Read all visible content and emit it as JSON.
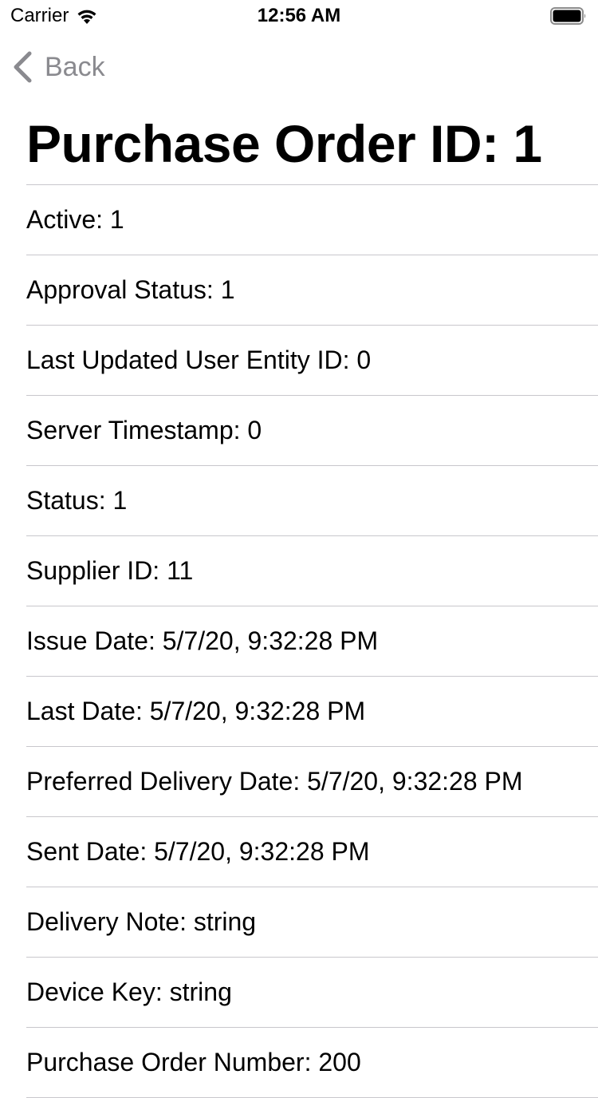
{
  "status_bar": {
    "carrier": "Carrier",
    "time": "12:56 AM",
    "wifi_icon": "wifi-icon",
    "battery_icon": "battery-icon"
  },
  "nav": {
    "back_label": "Back",
    "back_icon": "chevron-left-icon",
    "tint_color": "#8a8a8f"
  },
  "page": {
    "title": "Purchase Order ID: 1"
  },
  "fields": [
    {
      "label": "Active",
      "value": "1"
    },
    {
      "label": "Approval Status",
      "value": "1"
    },
    {
      "label": "Last Updated User Entity ID",
      "value": "0"
    },
    {
      "label": "Server Timestamp",
      "value": "0"
    },
    {
      "label": "Status",
      "value": "1"
    },
    {
      "label": "Supplier ID",
      "value": "11"
    },
    {
      "label": "Issue Date",
      "value": "5/7/20, 9:32:28 PM"
    },
    {
      "label": "Last Date",
      "value": "5/7/20, 9:32:28 PM"
    },
    {
      "label": "Preferred Delivery Date",
      "value": "5/7/20, 9:32:28 PM"
    },
    {
      "label": "Sent Date",
      "value": "5/7/20, 9:32:28 PM"
    },
    {
      "label": "Delivery Note",
      "value": "string"
    },
    {
      "label": "Device Key",
      "value": "string"
    },
    {
      "label": "Purchase Order Number",
      "value": "200"
    }
  ]
}
